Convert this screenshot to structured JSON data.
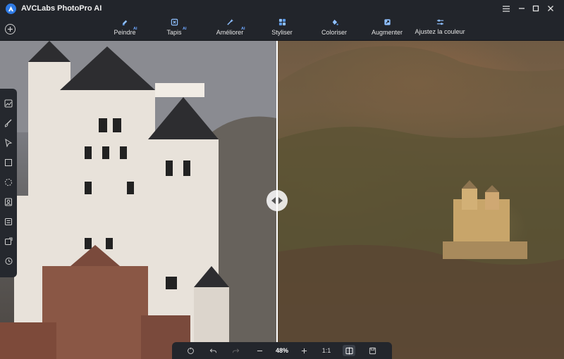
{
  "app": {
    "title": "AVCLabs PhotoPro AI"
  },
  "tabs": [
    {
      "label": "Peindre",
      "badge": "AI",
      "icon": "paint-icon"
    },
    {
      "label": "Tapis",
      "badge": "AI",
      "icon": "rug-icon"
    },
    {
      "label": "Améliorer",
      "badge": "AI",
      "icon": "enhance-icon"
    },
    {
      "label": "Styliser",
      "badge": "",
      "icon": "stylize-icon"
    },
    {
      "label": "Coloriser",
      "badge": "",
      "icon": "colorize-icon"
    },
    {
      "label": "Augmenter",
      "badge": "",
      "icon": "upscale-icon"
    },
    {
      "label": "Ajustez la couleur",
      "badge": "",
      "icon": "adjust-color-icon"
    }
  ],
  "window_controls": [
    "menu-icon",
    "minimize-icon",
    "maximize-icon",
    "close-icon"
  ],
  "tools": [
    "image-icon",
    "brush-icon",
    "pointer-icon",
    "rectangle-select-icon",
    "lasso-icon",
    "portrait-icon",
    "template-icon",
    "photo-edit-icon",
    "history-icon"
  ],
  "bottombar": {
    "zoom": "48%",
    "actual_size": "1:1"
  },
  "colors": {
    "accent": "#2f7be5",
    "badge": "#6ea7ff",
    "background": "#22252b"
  }
}
